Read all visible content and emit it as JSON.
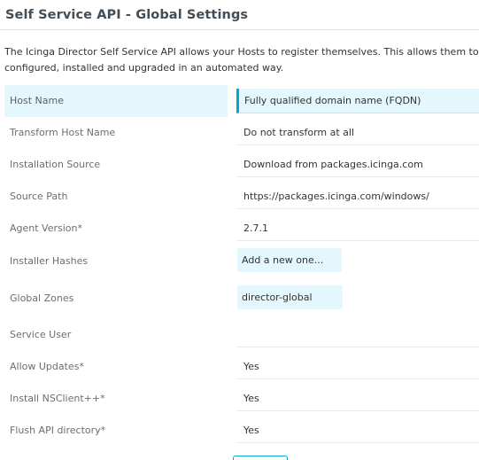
{
  "header": {
    "title": "Self Service API - Global Settings"
  },
  "intro": {
    "line1": "The Icinga Director Self Service API allows your Hosts to register themselves. This allows them to get their Icinga Agent",
    "line2": "configured, installed and upgraded in an automated way."
  },
  "form": {
    "host_name": {
      "label": "Host Name",
      "value": "Fully qualified domain name (FQDN)"
    },
    "transform_host_name": {
      "label": "Transform Host Name",
      "value": "Do not transform at all"
    },
    "installation_source": {
      "label": "Installation Source",
      "value": "Download from packages.icinga.com"
    },
    "source_path": {
      "label": "Source Path",
      "value": "https://packages.icinga.com/windows/"
    },
    "agent_version": {
      "label": "Agent Version*",
      "value": "2.7.1"
    },
    "installer_hashes": {
      "label": "Installer Hashes",
      "placeholder": "Add a new one..."
    },
    "global_zones": {
      "label": "Global Zones",
      "value": "director-global"
    },
    "service_user": {
      "label": "Service User",
      "value": ""
    },
    "allow_updates": {
      "label": "Allow Updates*",
      "value": "Yes"
    },
    "install_nsclient": {
      "label": "Install NSClient++*",
      "value": "Yes"
    },
    "flush_api_directory": {
      "label": "Flush API directory*",
      "value": "Yes"
    }
  },
  "colors": {
    "accent": "#00a8d2",
    "active_row_bg": "#e4f7fc",
    "title": "#434d56",
    "label": "#696e73"
  }
}
